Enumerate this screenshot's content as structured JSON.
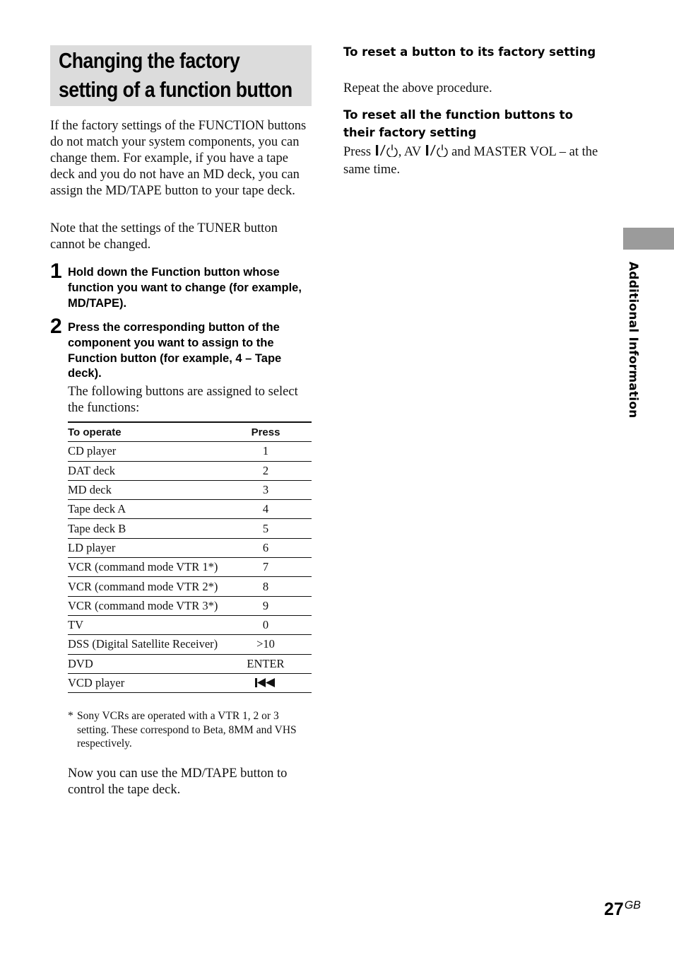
{
  "title": {
    "line1": "Changing the factory",
    "line2": "setting of a function button"
  },
  "intro": "If the factory settings of the FUNCTION buttons do not match your system components, you can change them. For example, if you have a tape deck and you do not have an MD deck, you can assign the MD/TAPE button to your tape deck.",
  "note": "Note that the settings of the TUNER button cannot be changed.",
  "steps": [
    {
      "number": "1",
      "text": "Hold down the Function button whose function you want to change (for example, MD/TAPE)."
    },
    {
      "number": "2",
      "text": "Press the corresponding button of the component you want to assign to the Function button (for example, 4 – Tape deck)."
    }
  ],
  "assigned_text": "The following buttons are assigned to select the functions:",
  "table": {
    "headers": [
      "To operate",
      "Press"
    ],
    "rows": [
      {
        "operate": "CD player",
        "press": "1"
      },
      {
        "operate": "DAT deck",
        "press": "2"
      },
      {
        "operate": "MD deck",
        "press": "3"
      },
      {
        "operate": "Tape deck A",
        "press": "4"
      },
      {
        "operate": "Tape deck B",
        "press": "5"
      },
      {
        "operate": "LD player",
        "press": "6"
      },
      {
        "operate": "VCR (command mode VTR 1*)",
        "press": "7"
      },
      {
        "operate": "VCR (command mode VTR 2*)",
        "press": "8"
      },
      {
        "operate": "VCR (command mode VTR 3*)",
        "press": "9"
      },
      {
        "operate": "TV",
        "press": "0"
      },
      {
        "operate": "DSS (Digital Satellite Receiver)",
        "press": ">10"
      },
      {
        "operate": "DVD",
        "press": "ENTER"
      },
      {
        "operate": "VCD player",
        "press": "",
        "press_icon": "skip-previous-icon"
      }
    ]
  },
  "footnote": {
    "mark": "*",
    "text": "Sony VCRs are operated with a VTR 1, 2 or 3 setting. These correspond to Beta, 8MM and VHS respectively."
  },
  "conclusion": "Now you can use the MD/TAPE button to control the tape deck.",
  "reset_one": {
    "heading": "To reset a button to its factory setting",
    "text": "Repeat the above procedure."
  },
  "reset_all": {
    "heading": "To reset all the function buttons to their factory setting",
    "press": "Press",
    "power_icon": "power-standby-icon",
    "comma_av": ", AV",
    "tail": "and MASTER VOL – at the same time."
  },
  "side_tab": {
    "label": "Additional Information",
    "color": "#9b9b9b"
  },
  "page": {
    "number": "27",
    "suffix": "GB"
  }
}
